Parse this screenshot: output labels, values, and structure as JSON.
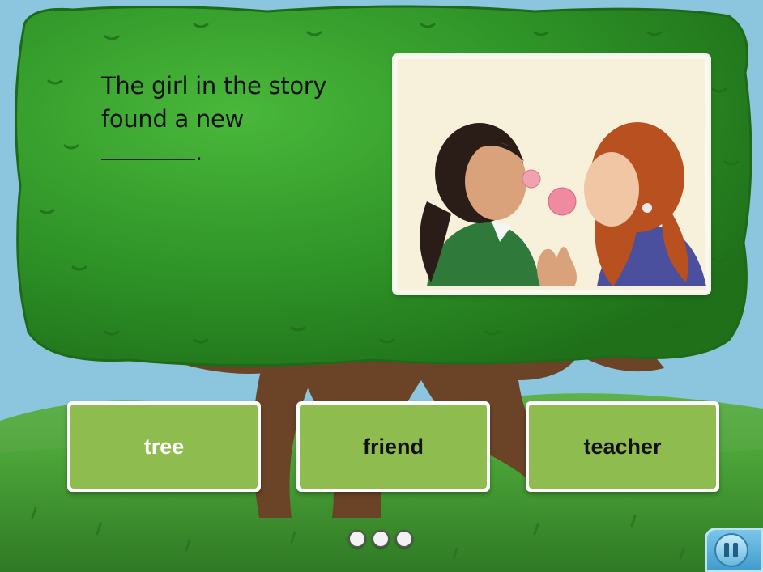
{
  "question": {
    "line1": "The girl in the story",
    "line2": "found a new",
    "end_punct": "."
  },
  "illustration": {
    "subject": "two girls blowing bubble gum bubbles"
  },
  "choices": [
    {
      "label": "tree"
    },
    {
      "label": "friend"
    },
    {
      "label": "teacher"
    }
  ],
  "progress": {
    "total_dots": 3,
    "current": 0
  },
  "pause_icon": "pause-icon",
  "colors": {
    "sky": "#8cc6de",
    "grass": "#3a8e2d",
    "canopy": "#2d8a23",
    "choice_fill": "#8fbc4f",
    "pause_blue": "#3d9ac9"
  }
}
